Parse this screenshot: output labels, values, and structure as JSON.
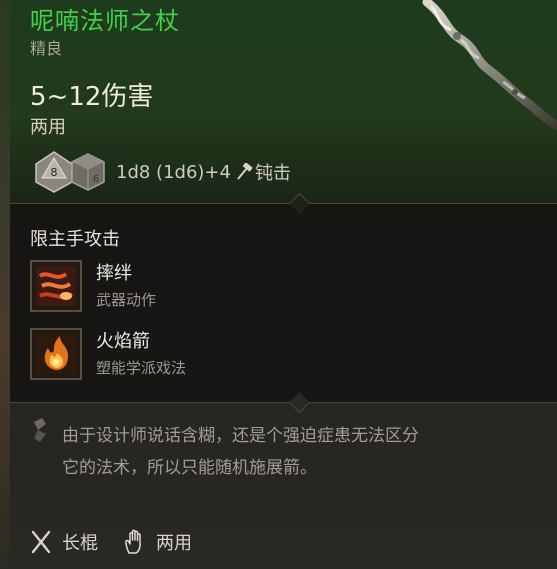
{
  "item": {
    "name": "呢喃法师之杖",
    "rarity": "精良",
    "damage": "5~12伤害",
    "handedness": "两用",
    "dice": {
      "die_primary": "8",
      "die_secondary": "6",
      "formula": "1d8 (1d6)+4",
      "damage_type": "钝击"
    }
  },
  "attacks": {
    "heading": "限主手攻击",
    "actions": [
      {
        "name": "摔绊",
        "category": "武器动作",
        "icon": "trip-attack-icon"
      },
      {
        "name": "火焰箭",
        "category": "塑能学派戏法",
        "icon": "fire-bolt-icon"
      }
    ]
  },
  "lore": "由于设计师说话含糊，还是个强迫症患无法区分它的法术，所以只能随机施展箭。",
  "properties": [
    {
      "label": "长棍",
      "icon": "crossed-staves-icon"
    },
    {
      "label": "两用",
      "icon": "hand-icon"
    }
  ],
  "colors": {
    "rarity_green": "#43d14a",
    "text_main": "#eeeae4",
    "text_muted": "#a29c94"
  }
}
